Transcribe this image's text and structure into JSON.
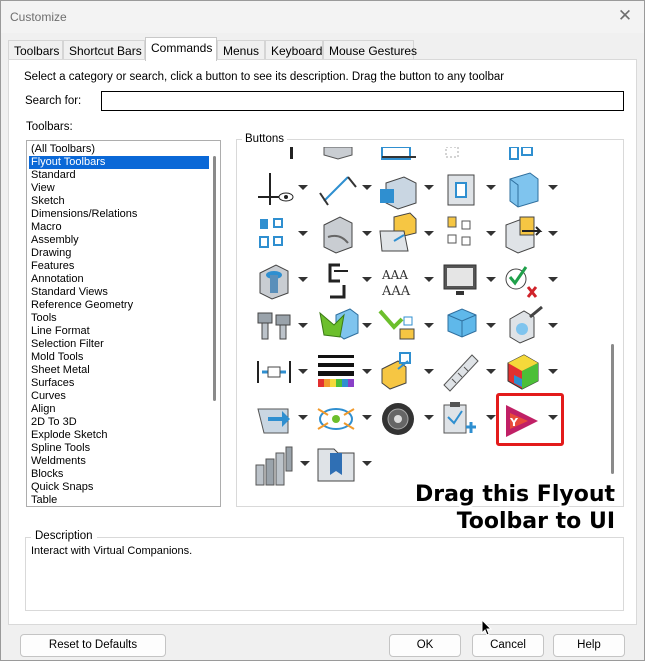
{
  "window": {
    "title": "Customize",
    "close_glyph": "✕"
  },
  "tabs": [
    {
      "label": "Toolbars"
    },
    {
      "label": "Shortcut Bars"
    },
    {
      "label": "Commands",
      "active": true
    },
    {
      "label": "Menus"
    },
    {
      "label": "Keyboard"
    },
    {
      "label": "Mouse Gestures"
    }
  ],
  "instruction": "Select a category or search, click a button to see its description. Drag the button to any toolbar",
  "search": {
    "label": "Search for:",
    "value": ""
  },
  "toolbars": {
    "label": "Toolbars:",
    "items": [
      "(All Toolbars)",
      "Flyout Toolbars",
      "Standard",
      "View",
      "Sketch",
      "Dimensions/Relations",
      "Macro",
      "Assembly",
      "Drawing",
      "Features",
      "Annotation",
      "Standard Views",
      "Reference Geometry",
      "Tools",
      "Line Format",
      "Selection Filter",
      "Mold Tools",
      "Sheet Metal",
      "Surfaces",
      "Curves",
      "Align",
      "2D To 3D",
      "Explode Sketch",
      "Spline Tools",
      "Weldments",
      "Blocks",
      "Quick Snaps",
      "Table"
    ],
    "selected_index": 1
  },
  "buttons": {
    "label": "Buttons",
    "icons": [
      "partial-row-icon-1",
      "partial-row-icon-2",
      "partial-row-icon-3",
      "partial-row-icon-4",
      "partial-row-icon-5",
      "view-orientation-icon",
      "dimension-icon",
      "box-view-icon",
      "section-view-icon",
      "display-style-icon",
      "configurations-icon",
      "fillet-icon",
      "assembly-icon",
      "smart-mates-icon",
      "replace-icon",
      "hole-wizard-icon",
      "reference-icon",
      "text-format-icon",
      "monitor-icon",
      "check-icon",
      "fasteners-icon",
      "move-body-icon",
      "insert-component-icon",
      "cube-icon",
      "appearance-icon",
      "distance-icon",
      "line-format-icon",
      "mate-icon",
      "ruler-icon",
      "color-cube-icon",
      "export-icon",
      "explode-icon",
      "camera-icon",
      "clipboard-add-icon",
      "virtual-companions-icon",
      "weldment-icon",
      "bookmark-folder-icon"
    ]
  },
  "overlay_text": {
    "line1": "Drag this Flyout",
    "line2": "Toolbar to UI"
  },
  "description": {
    "label": "Description",
    "text": "Interact with Virtual Companions."
  },
  "footer": {
    "reset_label": "Reset to Defaults",
    "ok_label": "OK",
    "cancel_label": "Cancel",
    "help_label": "Help"
  },
  "colors": {
    "highlight": "#e31b1b",
    "selection": "#0a68d7",
    "icon_blue": "#2f8fd0"
  }
}
